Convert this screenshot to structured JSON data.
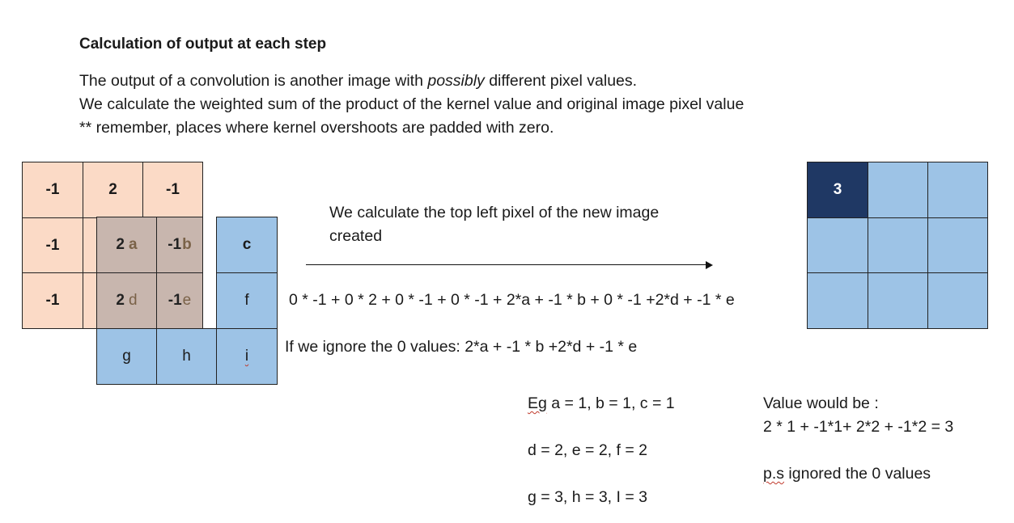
{
  "title": "Calculation of output at each step",
  "intro": {
    "line1_a": "The output of a convolution is another image with ",
    "line1_em": "possibly",
    "line1_b": " different pixel values.",
    "line2": "We calculate the weighted sum of the product of the kernel value and original image pixel value",
    "line3": "** remember, places where kernel overshoots are padded with zero."
  },
  "kernel": {
    "r0": [
      "-1",
      "2",
      "-1"
    ],
    "r1c0": "-1",
    "r2c0": "-1"
  },
  "overlap": {
    "r1c1_val": "2",
    "r1c1_var": "a",
    "r1c2_val": "-1",
    "r1c2_var": "b",
    "r2c1_val": "2",
    "r2c1_var": "d",
    "r2c2_val": "-1",
    "r2c2_var": "e"
  },
  "image": {
    "c": "c",
    "f": "f",
    "g": "g",
    "h": "h",
    "i": "i"
  },
  "arrow_text": {
    "line1": "We calculate the top left pixel of the new image",
    "line2": "created"
  },
  "formula": "0 * -1 + 0 * 2 + 0 * -1 + 0 * -1 + 2*a + -1 * b + 0 * -1 +2*d  + -1 * e",
  "ignore_text": "If we ignore the 0 values: 2*a + -1 * b +2*d  + -1 * e",
  "example": {
    "eg": "Eg",
    "line1_rest": " a = 1, b = 1, c = 1",
    "line2": "d = 2, e = 2, f = 2",
    "line3": "g = 3, h = 3, I = 3"
  },
  "value": {
    "line1": "Value would be :",
    "line2": "2 * 1 + -1*1+ 2*2 + -1*2 = 3",
    "ps": "p.s",
    "ps_rest": " ignored the 0 values"
  },
  "output": {
    "top_left": "3"
  },
  "colors": {
    "kernel_fill": "#fbdac6",
    "image_fill": "#9dc3e6",
    "overlap_fill": "#c8b6ae",
    "output_highlight": "#1f3864"
  }
}
